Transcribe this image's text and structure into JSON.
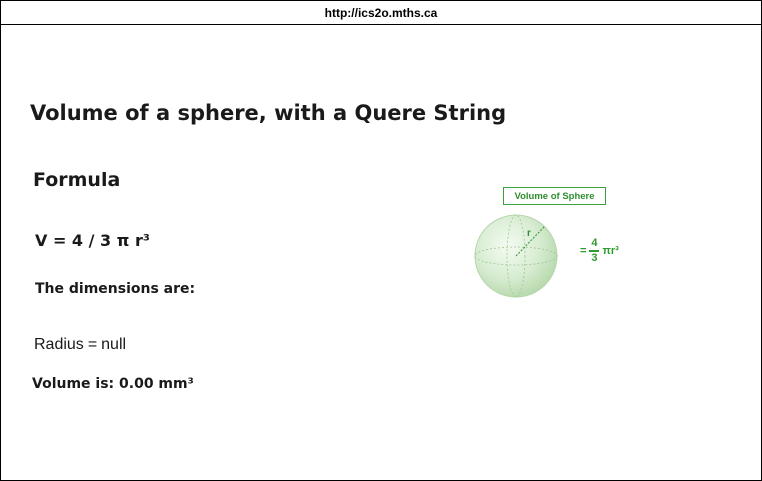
{
  "browser": {
    "url": "http://ics2o.mths.ca"
  },
  "page": {
    "title": "Volume of a sphere, with a Quere String",
    "formula_heading": "Formula",
    "formula": "V = 4 / 3 π r³",
    "dimensions_label": "The dimensions are:",
    "radius_label": "Radius",
    "radius_equals": "=",
    "radius_value": "null",
    "volume_text": "Volume is: 0.00 mm³"
  },
  "figure": {
    "label": "Volume of Sphere",
    "radius_letter": "r",
    "equation": {
      "equals": "=",
      "numerator": "4",
      "denominator": "3",
      "tail": "πr³"
    },
    "color_accent": "#2f9a2f",
    "color_sphere": "#cfe8c8"
  }
}
